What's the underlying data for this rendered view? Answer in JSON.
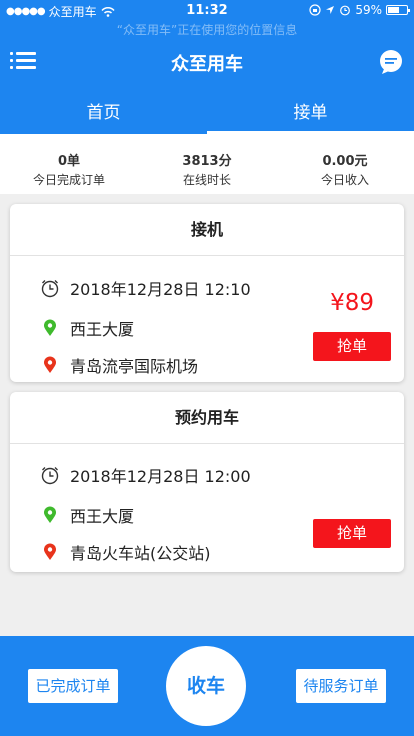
{
  "status_bar": {
    "carrier": "众至用车",
    "time": "11:32",
    "battery": "59%"
  },
  "location_banner": "“众至用车”正在使用您的位置信息",
  "header": {
    "title": "众至用车",
    "menu_icon": "menu-icon",
    "chat_icon": "chat-icon"
  },
  "tabs": [
    {
      "label": "首页",
      "active": false
    },
    {
      "label": "接单",
      "active": true
    }
  ],
  "stats": [
    {
      "value": "0单",
      "label": "今日完成订单"
    },
    {
      "value": "3813分",
      "label": "在线时长"
    },
    {
      "value": "0.00元",
      "label": "今日收入"
    }
  ],
  "orders": [
    {
      "type": "接机",
      "time": "2018年12月28日 12:10",
      "from": "西王大厦",
      "to": "青岛流亭国际机场",
      "price": "¥89",
      "action": "抢单"
    },
    {
      "type": "预约用车",
      "time": "2018年12月28日 12:00",
      "from": "西王大厦",
      "to": "青岛火车站(公交站)",
      "price": "",
      "action": "抢单"
    }
  ],
  "bottom_bar": {
    "completed_orders": "已完成订单",
    "center_action": "收车",
    "pending_orders": "待服务订单"
  },
  "colors": {
    "primary": "#1d85f0",
    "accent_red": "#f4151c",
    "origin_green": "#3fba2d",
    "destination_red": "#e8341c"
  }
}
